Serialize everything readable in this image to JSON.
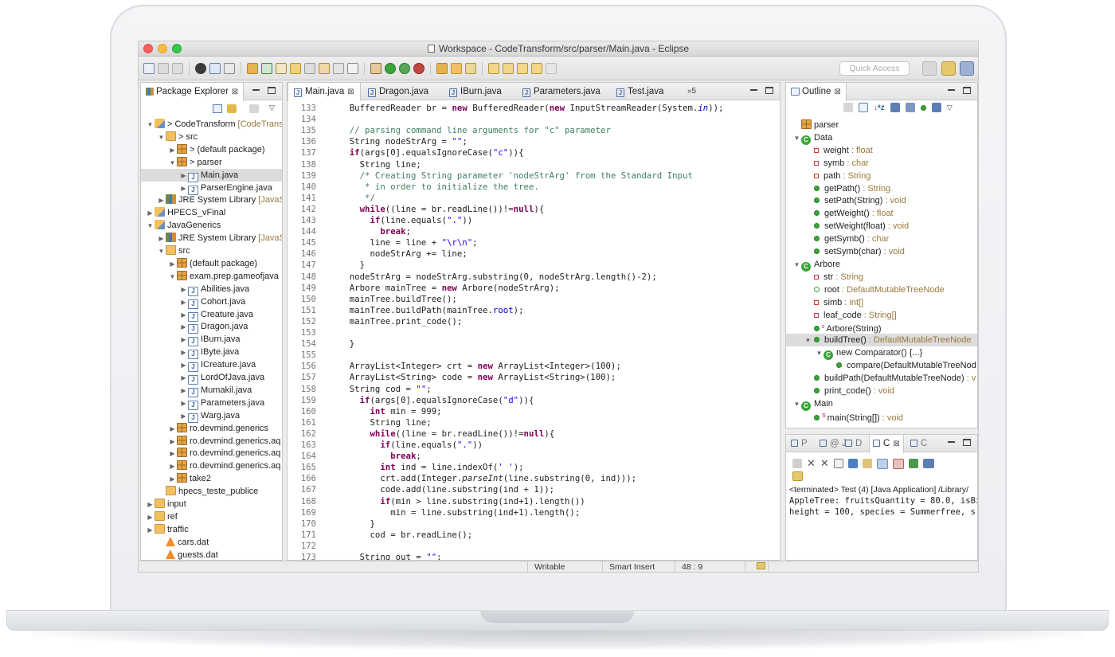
{
  "window": {
    "title": "Workspace - CodeTransform/src/parser/Main.java - Eclipse"
  },
  "toolbar": {
    "quick_access_placeholder": "Quick Access"
  },
  "package_explorer": {
    "title": "Package Explorer",
    "items": [
      {
        "level": 0,
        "arrow": "▼",
        "icon": "proj",
        "label": "> CodeTransform",
        "deco": " [CodeTransf"
      },
      {
        "level": 1,
        "arrow": "▼",
        "icon": "folder",
        "label": "> src",
        "deco": ""
      },
      {
        "level": 2,
        "arrow": "▶",
        "icon": "pkg",
        "label": "> (default package)",
        "deco": ""
      },
      {
        "level": 2,
        "arrow": "▼",
        "icon": "pkg",
        "label": "> parser",
        "deco": ""
      },
      {
        "level": 3,
        "arrow": "▶",
        "icon": "jfile",
        "label": "Main.java",
        "deco": "",
        "selected": true
      },
      {
        "level": 3,
        "arrow": "▶",
        "icon": "jfile",
        "label": "ParserEngine.java",
        "deco": ""
      },
      {
        "level": 1,
        "arrow": "▶",
        "icon": "lib",
        "label": "JRE System Library",
        "deco": " [JavaS"
      },
      {
        "level": 0,
        "arrow": "▶",
        "icon": "proj",
        "label": "HPECS_vFinal",
        "deco": ""
      },
      {
        "level": 0,
        "arrow": "▼",
        "icon": "proj",
        "label": "JavaGenerics",
        "deco": ""
      },
      {
        "level": 1,
        "arrow": "▶",
        "icon": "lib",
        "label": "JRE System Library",
        "deco": " [JavaS"
      },
      {
        "level": 1,
        "arrow": "▼",
        "icon": "folder",
        "label": "src",
        "deco": ""
      },
      {
        "level": 2,
        "arrow": "▶",
        "icon": "pkg",
        "label": "(default package)",
        "deco": ""
      },
      {
        "level": 2,
        "arrow": "▼",
        "icon": "pkg",
        "label": "exam.prep.gameofjava",
        "deco": ""
      },
      {
        "level": 3,
        "arrow": "▶",
        "icon": "jfile",
        "label": "Abilities.java",
        "deco": ""
      },
      {
        "level": 3,
        "arrow": "▶",
        "icon": "jfile",
        "label": "Cohort.java",
        "deco": ""
      },
      {
        "level": 3,
        "arrow": "▶",
        "icon": "jfile",
        "label": "Creature.java",
        "deco": ""
      },
      {
        "level": 3,
        "arrow": "▶",
        "icon": "jfile",
        "label": "Dragon.java",
        "deco": ""
      },
      {
        "level": 3,
        "arrow": "▶",
        "icon": "jfile",
        "label": "IBurn.java",
        "deco": ""
      },
      {
        "level": 3,
        "arrow": "▶",
        "icon": "jfile",
        "label": "IByte.java",
        "deco": ""
      },
      {
        "level": 3,
        "arrow": "▶",
        "icon": "jfile",
        "label": "ICreature.java",
        "deco": ""
      },
      {
        "level": 3,
        "arrow": "▶",
        "icon": "jfile",
        "label": "LordOfJava.java",
        "deco": ""
      },
      {
        "level": 3,
        "arrow": "▶",
        "icon": "jfile",
        "label": "Mumakil.java",
        "deco": ""
      },
      {
        "level": 3,
        "arrow": "▶",
        "icon": "jfile",
        "label": "Parameters.java",
        "deco": ""
      },
      {
        "level": 3,
        "arrow": "▶",
        "icon": "jfile",
        "label": "Warg.java",
        "deco": ""
      },
      {
        "level": 2,
        "arrow": "▶",
        "icon": "pkg",
        "label": "ro.devmind.generics",
        "deco": ""
      },
      {
        "level": 2,
        "arrow": "▶",
        "icon": "pkg",
        "label": "ro.devmind.generics.aq",
        "deco": ""
      },
      {
        "level": 2,
        "arrow": "▶",
        "icon": "pkg",
        "label": "ro.devmind.generics.aq",
        "deco": ""
      },
      {
        "level": 2,
        "arrow": "▶",
        "icon": "pkg",
        "label": "ro.devmind.generics.aq",
        "deco": ""
      },
      {
        "level": 2,
        "arrow": "▶",
        "icon": "pkg",
        "label": "take2",
        "deco": ""
      },
      {
        "level": 1,
        "arrow": "",
        "icon": "folder",
        "label": "hpecs_teste_publice",
        "deco": ""
      },
      {
        "level": 0,
        "arrow": "▶",
        "icon": "folder",
        "label": "input",
        "deco": ""
      },
      {
        "level": 0,
        "arrow": "▶",
        "icon": "folder",
        "label": "ref",
        "deco": ""
      },
      {
        "level": 0,
        "arrow": "▶",
        "icon": "folder",
        "label": "traffic",
        "deco": ""
      },
      {
        "level": 1,
        "arrow": "",
        "icon": "cone",
        "label": "cars.dat",
        "deco": ""
      },
      {
        "level": 1,
        "arrow": "",
        "icon": "cone",
        "label": "guests.dat",
        "deco": ""
      }
    ]
  },
  "editor": {
    "tabs": [
      "Main.java",
      "Dragon.java",
      "IBurn.java",
      "Parameters.java",
      "Test.java"
    ],
    "overflow": "»5",
    "lines": [
      {
        "n": "133",
        "tokens": [
          [
            "    ",
            ""
          ],
          [
            "BufferedReader br = ",
            ""
          ],
          [
            "new",
            "kw"
          ],
          [
            " BufferedReader(",
            ""
          ],
          [
            "new",
            "kw"
          ],
          [
            " InputStreamReader(System.",
            ""
          ],
          [
            "in",
            "fd it"
          ],
          [
            "));",
            ""
          ]
        ]
      },
      {
        "n": "134",
        "tokens": []
      },
      {
        "n": "135",
        "tokens": [
          [
            "    ",
            ""
          ],
          [
            "// parsing command line arguments for \"c\" parameter",
            "cm"
          ]
        ]
      },
      {
        "n": "136",
        "tokens": [
          [
            "    String nodeStrArg = ",
            ""
          ],
          [
            "\"\"",
            "st"
          ],
          [
            ";",
            ""
          ]
        ]
      },
      {
        "n": "137",
        "tokens": [
          [
            "    ",
            ""
          ],
          [
            "if",
            "kw"
          ],
          [
            "(args[0].equalsIgnoreCase(",
            ""
          ],
          [
            "\"c\"",
            "st"
          ],
          [
            ")){",
            ""
          ]
        ]
      },
      {
        "n": "138",
        "tokens": [
          [
            "      String line;",
            ""
          ]
        ]
      },
      {
        "n": "139",
        "tokens": [
          [
            "      ",
            ""
          ],
          [
            "/* Creating String parameter 'nodeStrArg' from the Standard Input",
            "cm"
          ]
        ]
      },
      {
        "n": "140",
        "tokens": [
          [
            "      ",
            ""
          ],
          [
            " * in order to initialize the tree.",
            "cm"
          ]
        ]
      },
      {
        "n": "141",
        "tokens": [
          [
            "      ",
            ""
          ],
          [
            " */",
            "cm"
          ]
        ]
      },
      {
        "n": "142",
        "tokens": [
          [
            "      ",
            ""
          ],
          [
            "while",
            "kw"
          ],
          [
            "((line = br.readLine())!=",
            ""
          ],
          [
            "null",
            "kw"
          ],
          [
            "){",
            ""
          ]
        ]
      },
      {
        "n": "143",
        "tokens": [
          [
            "        ",
            ""
          ],
          [
            "if",
            "kw"
          ],
          [
            "(line.equals(",
            ""
          ],
          [
            "\".\"",
            "st"
          ],
          [
            "))",
            ""
          ]
        ]
      },
      {
        "n": "144",
        "tokens": [
          [
            "          ",
            ""
          ],
          [
            "break",
            "kw"
          ],
          [
            ";",
            ""
          ]
        ]
      },
      {
        "n": "145",
        "tokens": [
          [
            "        line = line + ",
            ""
          ],
          [
            "\"\\r\\n\"",
            "st"
          ],
          [
            ";",
            ""
          ]
        ]
      },
      {
        "n": "146",
        "tokens": [
          [
            "        nodeStrArg += line;",
            ""
          ]
        ]
      },
      {
        "n": "147",
        "tokens": [
          [
            "      }",
            ""
          ]
        ]
      },
      {
        "n": "148",
        "tokens": [
          [
            "    nodeStrArg = nodeStrArg.substring(0, nodeStrArg.length()-2);",
            ""
          ]
        ]
      },
      {
        "n": "149",
        "tokens": [
          [
            "    Arbore mainTree = ",
            ""
          ],
          [
            "new",
            "kw"
          ],
          [
            " Arbore(nodeStrArg);",
            ""
          ]
        ]
      },
      {
        "n": "150",
        "tokens": [
          [
            "    mainTree.buildTree();",
            ""
          ]
        ]
      },
      {
        "n": "151",
        "tokens": [
          [
            "    mainTree.buildPath(mainTree.",
            ""
          ],
          [
            "root",
            "fd"
          ],
          [
            ");",
            ""
          ]
        ]
      },
      {
        "n": "152",
        "tokens": [
          [
            "    mainTree.print_code();",
            ""
          ]
        ]
      },
      {
        "n": "153",
        "tokens": []
      },
      {
        "n": "154",
        "tokens": [
          [
            "    }",
            ""
          ]
        ]
      },
      {
        "n": "155",
        "tokens": []
      },
      {
        "n": "156",
        "tokens": [
          [
            "    ArrayList<Integer> crt = ",
            ""
          ],
          [
            "new",
            "kw"
          ],
          [
            " ArrayList<Integer>(100);",
            ""
          ]
        ]
      },
      {
        "n": "157",
        "tokens": [
          [
            "    ArrayList<String> code = ",
            ""
          ],
          [
            "new",
            "kw"
          ],
          [
            " ArrayList<String>(100);",
            ""
          ]
        ]
      },
      {
        "n": "158",
        "tokens": [
          [
            "    String cod = ",
            ""
          ],
          [
            "\"\"",
            "st"
          ],
          [
            ";",
            ""
          ]
        ]
      },
      {
        "n": "159",
        "tokens": [
          [
            "      ",
            ""
          ],
          [
            "if",
            "kw"
          ],
          [
            "(args[0].equalsIgnoreCase(",
            ""
          ],
          [
            "\"d\"",
            "st"
          ],
          [
            ")){",
            ""
          ]
        ]
      },
      {
        "n": "160",
        "tokens": [
          [
            "        ",
            ""
          ],
          [
            "int",
            "kw"
          ],
          [
            " min = 999;",
            ""
          ]
        ]
      },
      {
        "n": "161",
        "tokens": [
          [
            "        String line;",
            ""
          ]
        ]
      },
      {
        "n": "162",
        "tokens": [
          [
            "        ",
            ""
          ],
          [
            "while",
            "kw"
          ],
          [
            "((line = br.readLine())!=",
            ""
          ],
          [
            "null",
            "kw"
          ],
          [
            "){",
            ""
          ]
        ]
      },
      {
        "n": "163",
        "tokens": [
          [
            "          ",
            ""
          ],
          [
            "if",
            "kw"
          ],
          [
            "(line.equals(",
            ""
          ],
          [
            "\".\"",
            "st"
          ],
          [
            "))",
            ""
          ]
        ]
      },
      {
        "n": "164",
        "tokens": [
          [
            "            ",
            ""
          ],
          [
            "break",
            "kw"
          ],
          [
            ";",
            ""
          ]
        ]
      },
      {
        "n": "165",
        "tokens": [
          [
            "          ",
            ""
          ],
          [
            "int",
            "kw"
          ],
          [
            " ind = line.indexOf(",
            ""
          ],
          [
            "' '",
            "st"
          ],
          [
            ");",
            ""
          ]
        ]
      },
      {
        "n": "166",
        "tokens": [
          [
            "          crt.add(Integer.",
            ""
          ],
          [
            "parseInt",
            "it"
          ],
          [
            "(line.substring(0, ind)));",
            ""
          ]
        ]
      },
      {
        "n": "167",
        "tokens": [
          [
            "          code.add(line.substring(ind + 1));",
            ""
          ]
        ]
      },
      {
        "n": "168",
        "tokens": [
          [
            "          ",
            ""
          ],
          [
            "if",
            "kw"
          ],
          [
            "(min > line.substring(ind+1).length())",
            ""
          ]
        ]
      },
      {
        "n": "169",
        "tokens": [
          [
            "            min = line.substring(ind+1).length();",
            ""
          ]
        ]
      },
      {
        "n": "170",
        "tokens": [
          [
            "        }",
            ""
          ]
        ]
      },
      {
        "n": "171",
        "tokens": [
          [
            "        cod = br.readLine();",
            ""
          ]
        ]
      },
      {
        "n": "172",
        "tokens": []
      },
      {
        "n": "173",
        "tokens": [
          [
            "      String out = ",
            ""
          ],
          [
            "\"\"",
            "st"
          ],
          [
            ";",
            ""
          ]
        ]
      }
    ]
  },
  "status": {
    "writable": "Writable",
    "insert_mode": "Smart Insert",
    "position": "48 : 9"
  },
  "outline": {
    "title": "Outline",
    "items": [
      {
        "level": 0,
        "kind": "pkg",
        "label": "parser",
        "type": ""
      },
      {
        "level": 0,
        "kind": "class",
        "arrow": "▼",
        "label": "Data",
        "type": ""
      },
      {
        "level": 1,
        "kind": "pri",
        "label": "weight",
        "type": " : float"
      },
      {
        "level": 1,
        "kind": "pri",
        "label": "symb",
        "type": " : char"
      },
      {
        "level": 1,
        "kind": "pri",
        "label": "path",
        "type": " : String"
      },
      {
        "level": 1,
        "kind": "pub",
        "label": "getPath()",
        "type": " : String"
      },
      {
        "level": 1,
        "kind": "pub",
        "label": "setPath(String)",
        "type": " : void"
      },
      {
        "level": 1,
        "kind": "pub",
        "label": "getWeight()",
        "type": " : float"
      },
      {
        "level": 1,
        "kind": "pub",
        "label": "setWeight(float)",
        "type": " : void"
      },
      {
        "level": 1,
        "kind": "pub",
        "label": "getSymb()",
        "type": " : char"
      },
      {
        "level": 1,
        "kind": "pub",
        "label": "setSymb(char)",
        "type": " : void"
      },
      {
        "level": 0,
        "kind": "class",
        "arrow": "▼",
        "label": "Arbore",
        "type": ""
      },
      {
        "level": 1,
        "kind": "pri",
        "label": "str",
        "type": " : String"
      },
      {
        "level": 1,
        "kind": "pkgv",
        "label": "root",
        "type": " : DefaultMutableTreeNode"
      },
      {
        "level": 1,
        "kind": "pri",
        "label": "simb",
        "type": " : int[]"
      },
      {
        "level": 1,
        "kind": "pri",
        "label": "leaf_code",
        "type": " : String[]"
      },
      {
        "level": 1,
        "kind": "pub",
        "sup": "c",
        "label": "Arbore(String)",
        "type": ""
      },
      {
        "level": 1,
        "kind": "pub",
        "arrow": "▼",
        "label": "buildTree()",
        "type": " : DefaultMutableTreeNode",
        "selected": true
      },
      {
        "level": 2,
        "kind": "class",
        "arrow": "▼",
        "label": "new Comparator() {...}",
        "type": ""
      },
      {
        "level": 3,
        "kind": "pub",
        "label": "compare(DefaultMutableTreeNod",
        "type": ""
      },
      {
        "level": 1,
        "kind": "pub",
        "label": "buildPath(DefaultMutableTreeNode)",
        "type": " : v"
      },
      {
        "level": 1,
        "kind": "pub",
        "label": "print_code()",
        "type": " : void"
      },
      {
        "level": 0,
        "kind": "class",
        "arrow": "▼",
        "label": "Main",
        "type": ""
      },
      {
        "level": 1,
        "kind": "pub",
        "sup": "S",
        "label": "main(String[])",
        "type": " : void"
      }
    ]
  },
  "console": {
    "tabs": [
      "P",
      "@ J",
      "D",
      "C",
      "C"
    ],
    "terminated": "<terminated> Test (4) [Java Application] /Library/",
    "lines": [
      "AppleTree: fruitsQuantity = 80.0,  isBi",
      "height = 100,  species = Summerfree,  s"
    ]
  },
  "colors": {
    "keyword": "#7f0055",
    "string": "#2a00ff",
    "comment": "#3f7f5f",
    "field": "#0000c0"
  }
}
